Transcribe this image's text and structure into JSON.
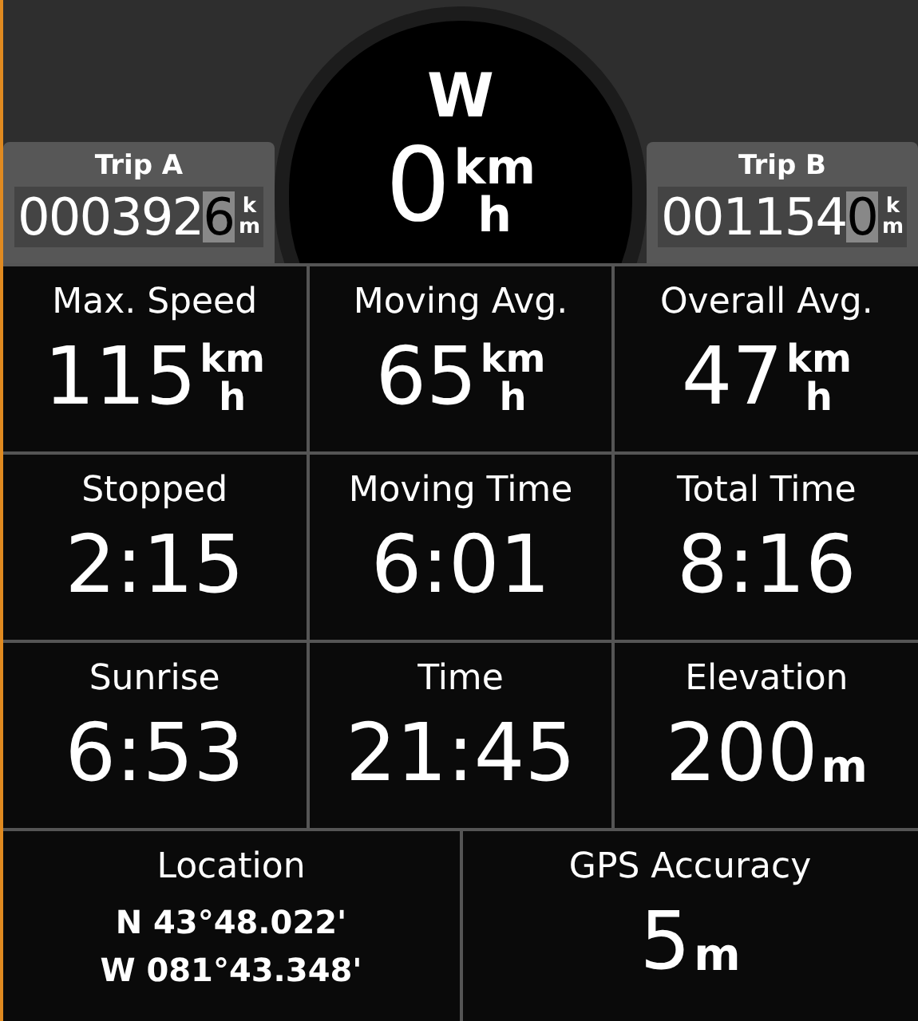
{
  "compass": {
    "heading": "W"
  },
  "speed": {
    "value": "0",
    "unit_top": "km",
    "unit_bottom": "h"
  },
  "trips": [
    {
      "label": "Trip A",
      "digits": "000392",
      "last_digit": "6",
      "unit_top": "k",
      "unit_bottom": "m"
    },
    {
      "label": "Trip B",
      "digits": "001154",
      "last_digit": "0",
      "unit_top": "k",
      "unit_bottom": "m"
    }
  ],
  "fields": [
    {
      "label": "Max. Speed",
      "kind": "rate",
      "value": "115",
      "unit_top": "km",
      "unit_bottom": "h"
    },
    {
      "label": "Moving Avg.",
      "kind": "rate",
      "value": "65",
      "unit_top": "km",
      "unit_bottom": "h"
    },
    {
      "label": "Overall Avg.",
      "kind": "rate",
      "value": "47",
      "unit_top": "km",
      "unit_bottom": "h"
    },
    {
      "label": "Stopped",
      "kind": "plain",
      "value": "2:15"
    },
    {
      "label": "Moving Time",
      "kind": "plain",
      "value": "6:01"
    },
    {
      "label": "Total Time",
      "kind": "plain",
      "value": "8:16"
    },
    {
      "label": "Sunrise",
      "kind": "plain",
      "value": "6:53"
    },
    {
      "label": "Time",
      "kind": "plain",
      "value": "21:45"
    },
    {
      "label": "Elevation",
      "kind": "unit",
      "value": "200",
      "unit": "m"
    }
  ],
  "bottom_fields": [
    {
      "label": "Location",
      "kind": "coords",
      "lines": [
        "N 43°48.022'",
        "W 081°43.348'"
      ]
    },
    {
      "label": "GPS Accuracy",
      "kind": "unit",
      "value": "5",
      "unit": "m"
    }
  ]
}
